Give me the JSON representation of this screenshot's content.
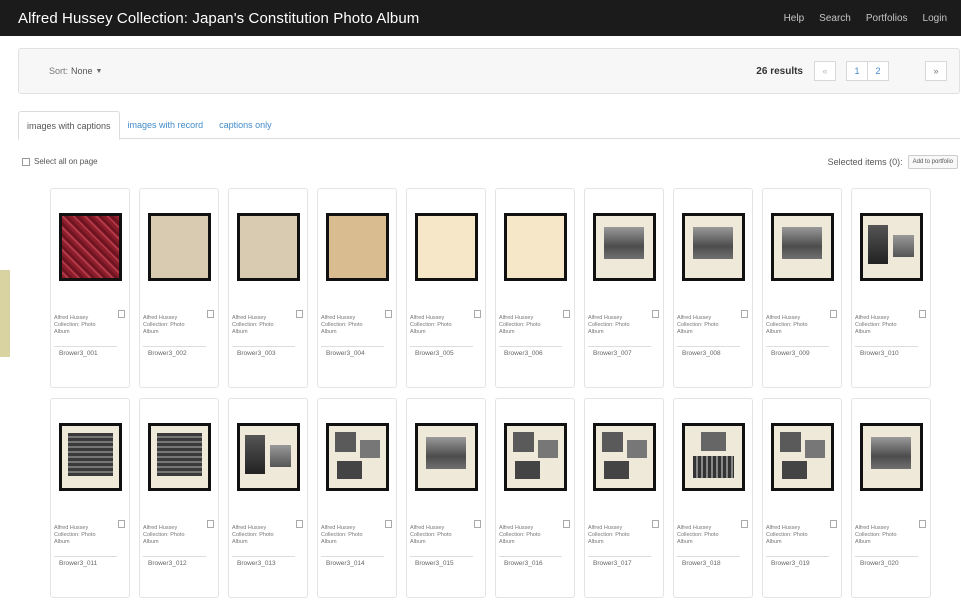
{
  "header": {
    "title": "Alfred Hussey Collection: Japan's Constitution Photo Album",
    "nav": [
      "Help",
      "Search",
      "Portfolios",
      "Login"
    ]
  },
  "toolbar": {
    "sort_label": "Sort:",
    "sort_value": "None",
    "results": "26 results",
    "pager": {
      "prev": "«",
      "pages": [
        "1",
        "2"
      ],
      "next": "»"
    }
  },
  "tabs": [
    "images with captions",
    "images with record",
    "captions only"
  ],
  "selection": {
    "select_all": "Select all on page",
    "selected_items": "Selected items (0):",
    "add_button": "Add to portfolio"
  },
  "item_title_lines": [
    "Alfred Hussey",
    "Collection: Photo",
    "Album"
  ],
  "items": [
    {
      "id": "Brower3_001",
      "thumb": "red-cover"
    },
    {
      "id": "Brower3_002",
      "thumb": "paper-gray"
    },
    {
      "id": "Brower3_003",
      "thumb": "paper-gray"
    },
    {
      "id": "Brower3_004",
      "thumb": "paper-tan"
    },
    {
      "id": "Brower3_005",
      "thumb": "paper-cream"
    },
    {
      "id": "Brower3_006",
      "thumb": "paper-cream"
    },
    {
      "id": "Brower3_007",
      "thumb": "photo-single"
    },
    {
      "id": "Brower3_008",
      "thumb": "photo-single"
    },
    {
      "id": "Brower3_009",
      "thumb": "photo-single"
    },
    {
      "id": "Brower3_010",
      "thumb": "photo-two-side"
    },
    {
      "id": "Brower3_011",
      "thumb": "photo-large"
    },
    {
      "id": "Brower3_012",
      "thumb": "photo-large"
    },
    {
      "id": "Brower3_013",
      "thumb": "photo-two-side"
    },
    {
      "id": "Brower3_014",
      "thumb": "photo-collage"
    },
    {
      "id": "Brower3_015",
      "thumb": "photo-single"
    },
    {
      "id": "Brower3_016",
      "thumb": "photo-collage"
    },
    {
      "id": "Brower3_017",
      "thumb": "photo-collage"
    },
    {
      "id": "Brower3_018",
      "thumb": "photo-stack"
    },
    {
      "id": "Brower3_019",
      "thumb": "photo-collage"
    },
    {
      "id": "Brower3_020",
      "thumb": "photo-single"
    }
  ],
  "colors": {
    "navbar": "#1b1b1b",
    "link": "#428bca",
    "side_tab": "#d9d3a2"
  }
}
